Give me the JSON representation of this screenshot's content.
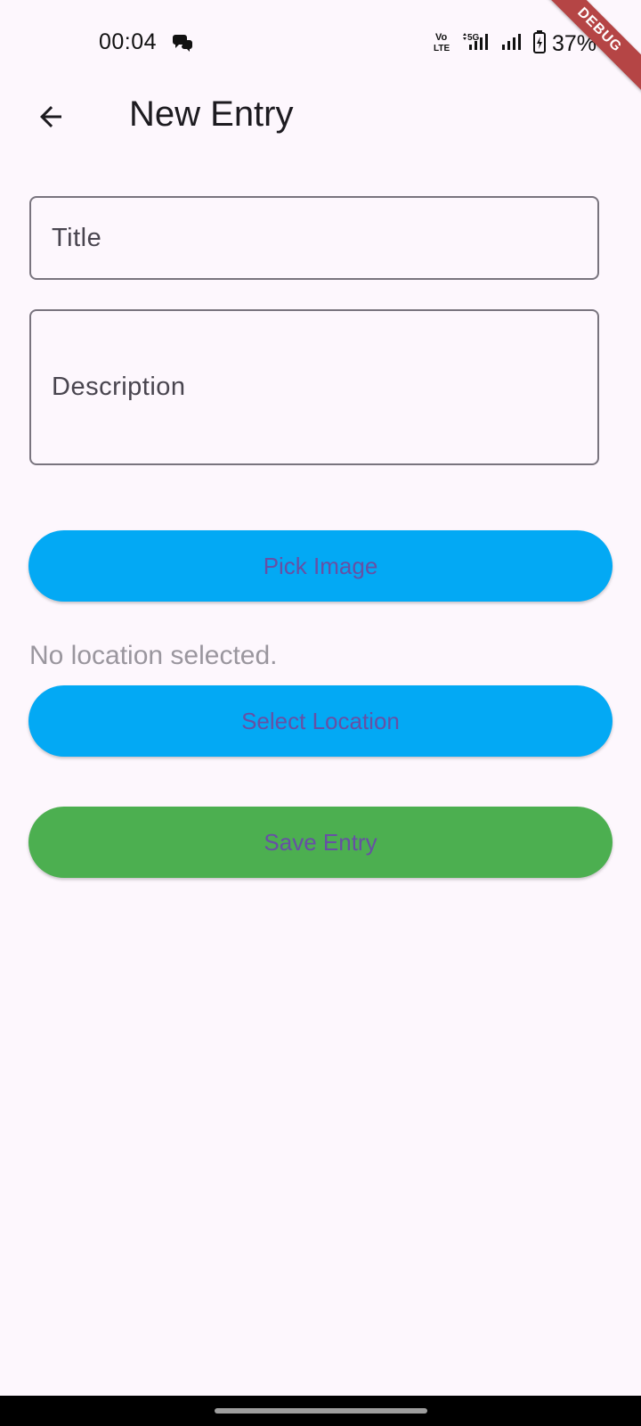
{
  "status_bar": {
    "time": "00:04",
    "battery_text": "37%",
    "icons": [
      "chat-bubbles-icon",
      "volte-icon",
      "signal-5g-icon",
      "signal-icon",
      "battery-charging-icon"
    ]
  },
  "debug_banner": "DEBUG",
  "app_bar": {
    "back_icon": "arrow-back-icon",
    "title": "New Entry"
  },
  "form": {
    "title_label": "Title",
    "description_label": "Description",
    "pick_image_label": "Pick Image",
    "location_status": "No location selected.",
    "select_location_label": "Select Location",
    "save_entry_label": "Save Entry"
  },
  "colors": {
    "background": "#fdf7fd",
    "primary_button": "#03a9f4",
    "save_button": "#4caf50",
    "button_text": "#6750a4",
    "debug_banner": "#b54545"
  }
}
